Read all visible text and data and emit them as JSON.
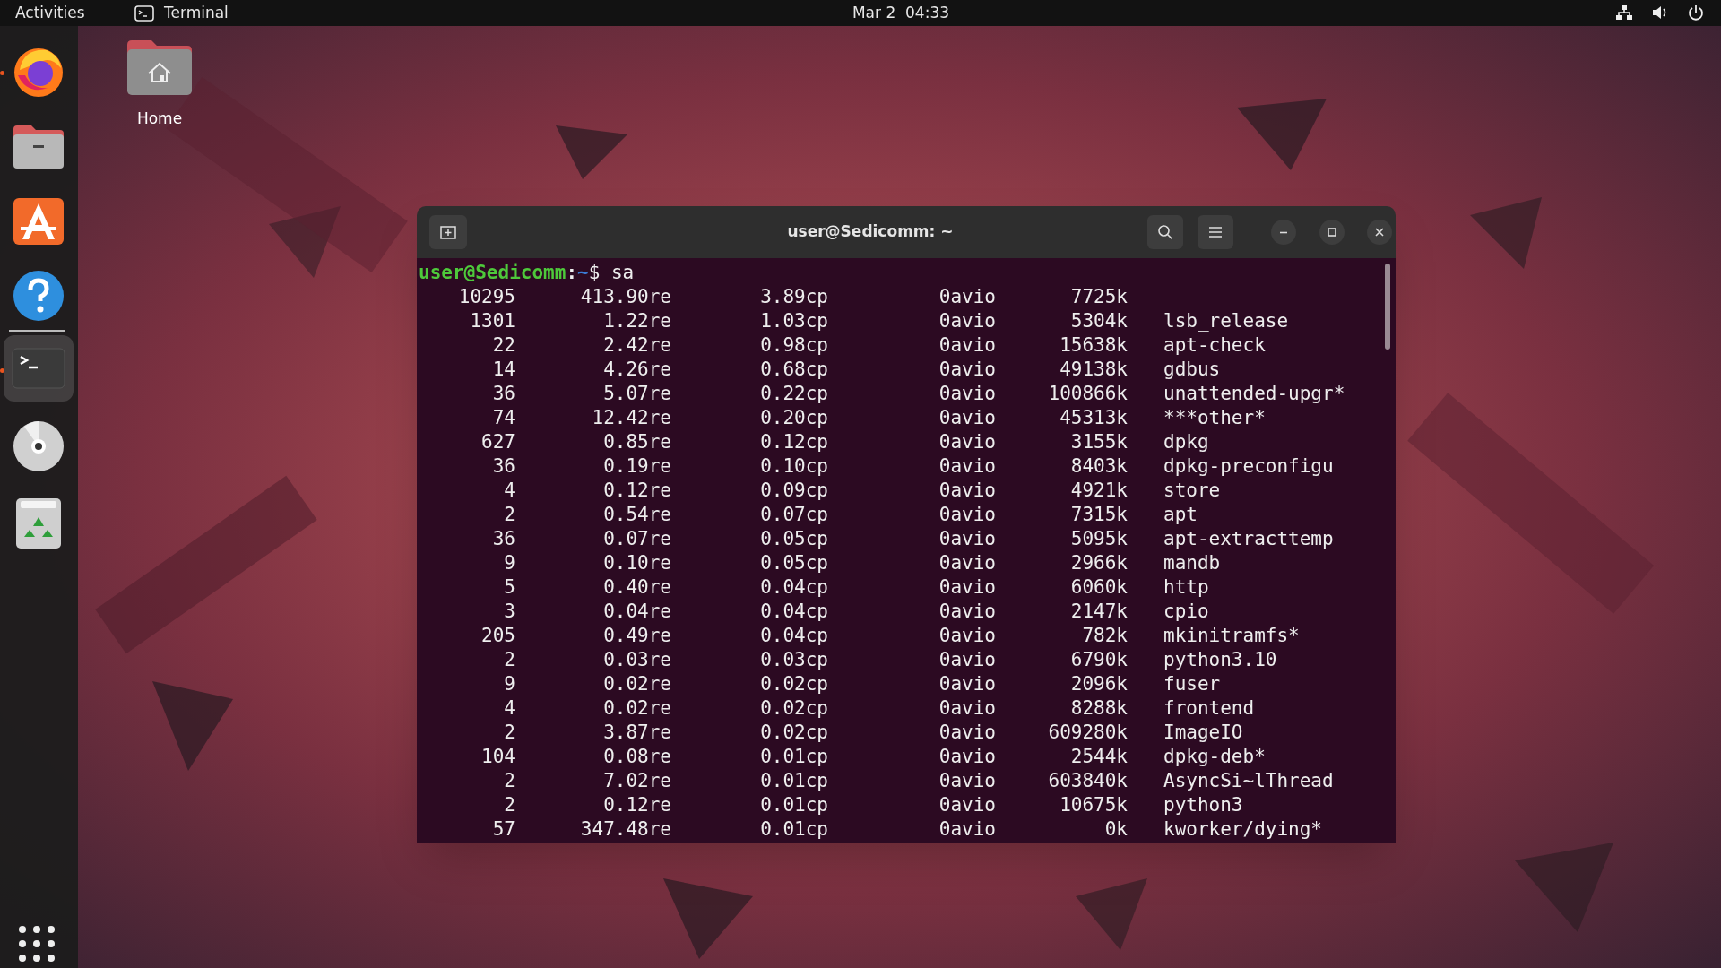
{
  "top_bar": {
    "activities": "Activities",
    "app": "Terminal",
    "clock": "Mar 2  04:33"
  },
  "dock": {
    "items": [
      {
        "kind": "firefox",
        "running": true,
        "selected": false
      },
      {
        "kind": "files",
        "running": false,
        "selected": false
      },
      {
        "kind": "appstore",
        "running": false,
        "selected": false
      },
      {
        "kind": "help",
        "running": false,
        "selected": false
      },
      {
        "kind": "terminal",
        "running": true,
        "selected": true
      },
      {
        "kind": "disc",
        "running": false,
        "selected": false
      },
      {
        "kind": "trash",
        "running": false,
        "selected": false
      }
    ]
  },
  "desktop": {
    "icons": [
      {
        "label": "Home"
      }
    ]
  },
  "window": {
    "title": "user@Sedicomm: ~",
    "prompt": {
      "user_host": "user@Sedicomm",
      "separator": ":",
      "path": "~",
      "symbol": "$",
      "command": "sa"
    },
    "rows": [
      {
        "count": "10295",
        "real": "413.90re",
        "cpu": "3.89cp",
        "io": "0avio",
        "memory": "7725k"
      },
      {
        "count": "1301",
        "real": "1.22re",
        "cpu": "1.03cp",
        "io": "0avio",
        "memory": "5304k",
        "command": "lsb_release"
      },
      {
        "count": "22",
        "real": "2.42re",
        "cpu": "0.98cp",
        "io": "0avio",
        "memory": "15638k",
        "command": "apt-check"
      },
      {
        "count": "14",
        "real": "4.26re",
        "cpu": "0.68cp",
        "io": "0avio",
        "memory": "49138k",
        "command": "gdbus"
      },
      {
        "count": "36",
        "real": "5.07re",
        "cpu": "0.22cp",
        "io": "0avio",
        "memory": "100866k",
        "command": "unattended-upgr*"
      },
      {
        "count": "74",
        "real": "12.42re",
        "cpu": "0.20cp",
        "io": "0avio",
        "memory": "45313k",
        "command": "***other*"
      },
      {
        "count": "627",
        "real": "0.85re",
        "cpu": "0.12cp",
        "io": "0avio",
        "memory": "3155k",
        "command": "dpkg"
      },
      {
        "count": "36",
        "real": "0.19re",
        "cpu": "0.10cp",
        "io": "0avio",
        "memory": "8403k",
        "command": "dpkg-preconfigu"
      },
      {
        "count": "4",
        "real": "0.12re",
        "cpu": "0.09cp",
        "io": "0avio",
        "memory": "4921k",
        "command": "store"
      },
      {
        "count": "2",
        "real": "0.54re",
        "cpu": "0.07cp",
        "io": "0avio",
        "memory": "7315k",
        "command": "apt"
      },
      {
        "count": "36",
        "real": "0.07re",
        "cpu": "0.05cp",
        "io": "0avio",
        "memory": "5095k",
        "command": "apt-extracttemp"
      },
      {
        "count": "9",
        "real": "0.10re",
        "cpu": "0.05cp",
        "io": "0avio",
        "memory": "2966k",
        "command": "mandb"
      },
      {
        "count": "5",
        "real": "0.40re",
        "cpu": "0.04cp",
        "io": "0avio",
        "memory": "6060k",
        "command": "http"
      },
      {
        "count": "3",
        "real": "0.04re",
        "cpu": "0.04cp",
        "io": "0avio",
        "memory": "2147k",
        "command": "cpio"
      },
      {
        "count": "205",
        "real": "0.49re",
        "cpu": "0.04cp",
        "io": "0avio",
        "memory": "782k",
        "command": "mkinitramfs*"
      },
      {
        "count": "2",
        "real": "0.03re",
        "cpu": "0.03cp",
        "io": "0avio",
        "memory": "6790k",
        "command": "python3.10"
      },
      {
        "count": "9",
        "real": "0.02re",
        "cpu": "0.02cp",
        "io": "0avio",
        "memory": "2096k",
        "command": "fuser"
      },
      {
        "count": "4",
        "real": "0.02re",
        "cpu": "0.02cp",
        "io": "0avio",
        "memory": "8288k",
        "command": "frontend"
      },
      {
        "count": "2",
        "real": "3.87re",
        "cpu": "0.02cp",
        "io": "0avio",
        "memory": "609280k",
        "command": "ImageIO"
      },
      {
        "count": "104",
        "real": "0.08re",
        "cpu": "0.01cp",
        "io": "0avio",
        "memory": "2544k",
        "command": "dpkg-deb*"
      },
      {
        "count": "2",
        "real": "7.02re",
        "cpu": "0.01cp",
        "io": "0avio",
        "memory": "603840k",
        "command": "AsyncSi~lThread"
      },
      {
        "count": "2",
        "real": "0.12re",
        "cpu": "0.01cp",
        "io": "0avio",
        "memory": "10675k",
        "command": "python3"
      },
      {
        "count": "57",
        "real": "347.48re",
        "cpu": "0.01cp",
        "io": "0avio",
        "memory": "0k",
        "command": "kworker/dying*"
      }
    ]
  }
}
